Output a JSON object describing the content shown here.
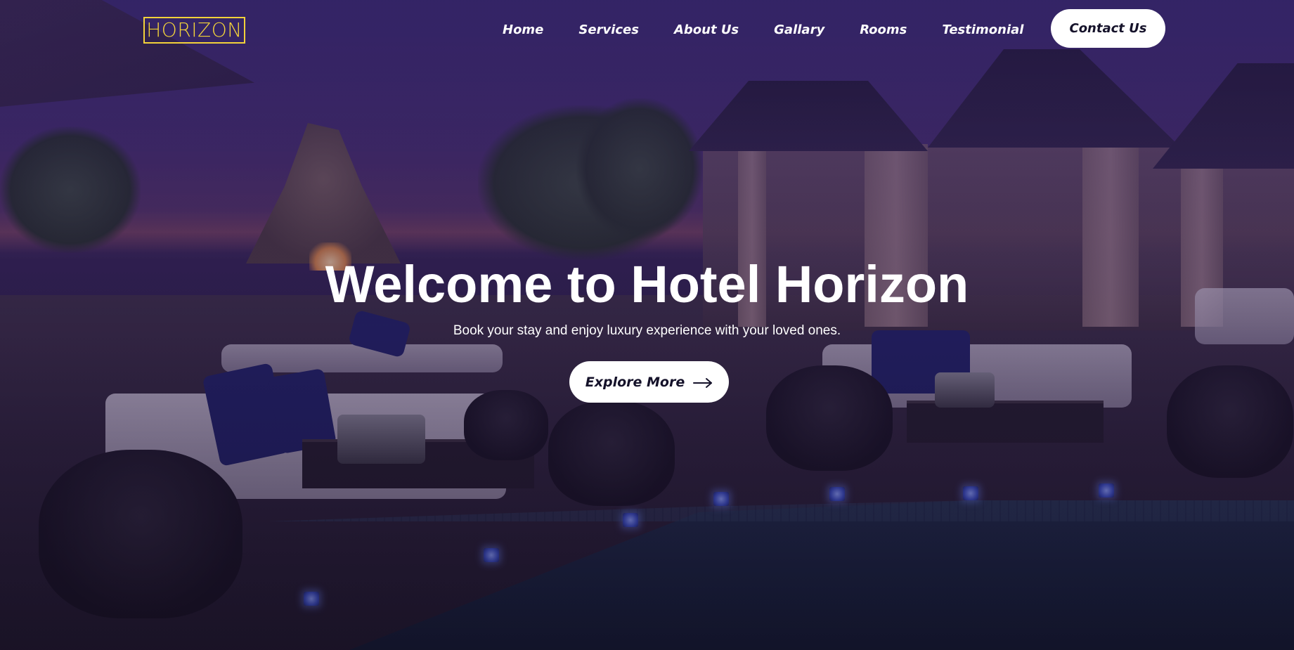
{
  "brand": {
    "logo_text": "HORIZON",
    "logo_color": "#f2d23a"
  },
  "nav": {
    "items": [
      {
        "label": "Home"
      },
      {
        "label": "Services"
      },
      {
        "label": "About Us"
      },
      {
        "label": "Gallary"
      },
      {
        "label": "Rooms"
      },
      {
        "label": "Testimonial"
      }
    ],
    "contact_label": "Contact Us"
  },
  "hero": {
    "title": "Welcome to Hotel Horizon",
    "subtitle": "Book your stay and enjoy luxury experience with your loved ones.",
    "cta_label": "Explore More",
    "cta_icon": "arrow-right-icon",
    "background": "rooftop-pool-lounge-at-dusk"
  },
  "colors": {
    "overlay": "#2a1860",
    "button_bg": "#ffffff",
    "button_text": "#15122a"
  }
}
